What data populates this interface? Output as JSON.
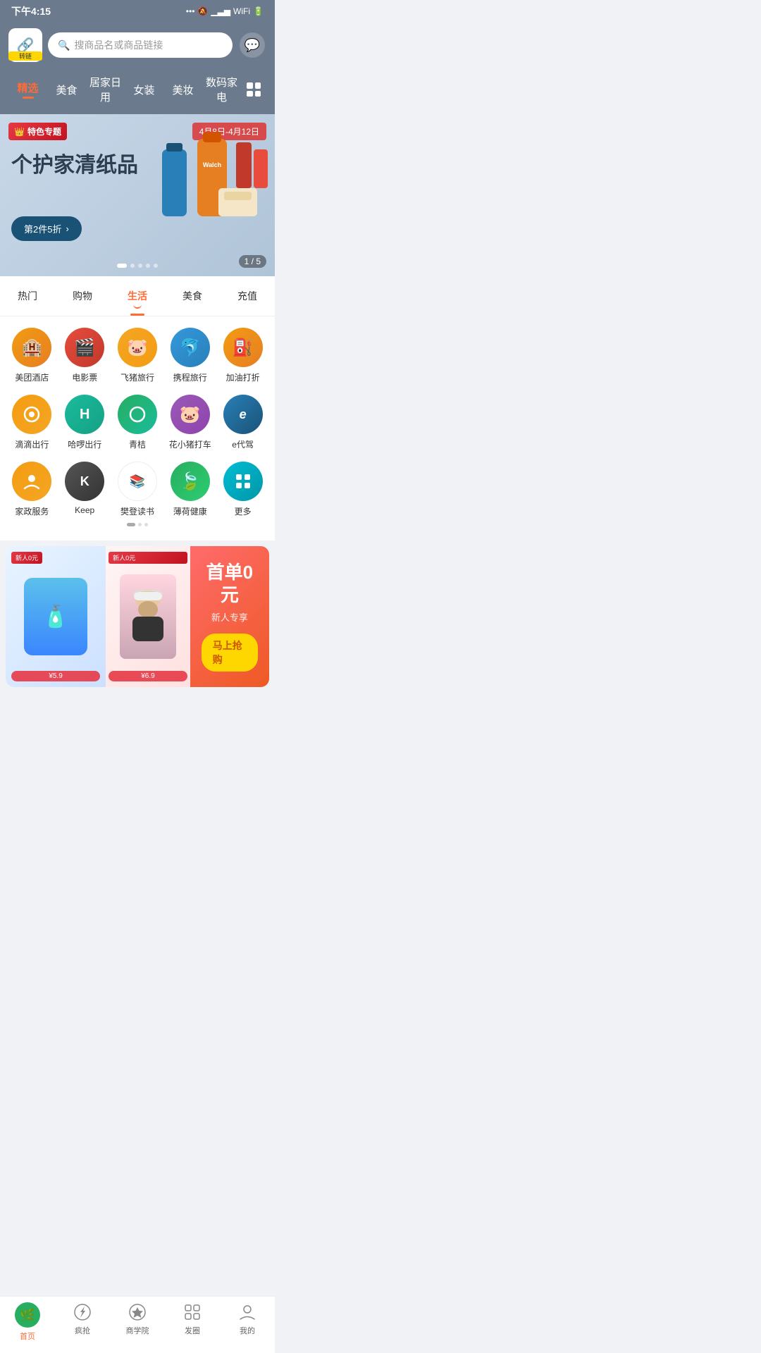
{
  "statusBar": {
    "time": "下午4:15",
    "icons": "... 🔕 📶 WiFi 🔋"
  },
  "header": {
    "logoLabel": "转链",
    "searchPlaceholder": "搜商品名或商品链接"
  },
  "navTabs": [
    {
      "id": "jingxuan",
      "label": "精选",
      "active": true
    },
    {
      "id": "meishi",
      "label": "美食",
      "active": false
    },
    {
      "id": "jujiadiyong",
      "label": "居家日用",
      "active": false
    },
    {
      "id": "nvzhuang",
      "label": "女装",
      "active": false
    },
    {
      "id": "meizhuang",
      "label": "美妆",
      "active": false
    },
    {
      "id": "shumajiadian",
      "label": "数码家电",
      "active": false
    }
  ],
  "banner": {
    "tag": "特色专题",
    "dateRange": "4月8日-4月12日",
    "title": "个护家清纸品",
    "ctaLabel": "第2件5折",
    "ctaArrow": "›",
    "counter": "1 / 5"
  },
  "categoryTabs": [
    {
      "label": "热门",
      "active": false
    },
    {
      "label": "购物",
      "active": false
    },
    {
      "label": "生活",
      "active": true
    },
    {
      "label": "美食",
      "active": false
    },
    {
      "label": "充值",
      "active": false
    }
  ],
  "appGrid": {
    "rows": [
      [
        {
          "id": "meituan-hotel",
          "icon": "🏨",
          "label": "美团酒店",
          "color": "ic-orange"
        },
        {
          "id": "movie-ticket",
          "icon": "🎬",
          "label": "电影票",
          "color": "ic-red"
        },
        {
          "id": "fliggy",
          "icon": "🐷",
          "label": "飞猪旅行",
          "color": "ic-orange2"
        },
        {
          "id": "ctrip",
          "icon": "🐬",
          "label": "携程旅行",
          "color": "ic-blue"
        },
        {
          "id": "gas-station",
          "icon": "⛽",
          "label": "加油打折",
          "color": "ic-amber"
        }
      ],
      [
        {
          "id": "didi",
          "icon": "◎",
          "label": "滴滴出行",
          "color": "ic-orange-light"
        },
        {
          "id": "hellobike",
          "icon": "H",
          "label": "哈啰出行",
          "color": "ic-teal"
        },
        {
          "id": "qingju",
          "icon": "◌",
          "label": "青桔",
          "color": "ic-green-teal"
        },
        {
          "id": "huaxiaozhu",
          "icon": "🐷",
          "label": "花小猪打车",
          "color": "ic-purple"
        },
        {
          "id": "edaijia",
          "icon": "e",
          "label": "e代驾",
          "color": "ic-blue2"
        }
      ],
      [
        {
          "id": "jiazhengliao",
          "icon": "☺",
          "label": "家政服务",
          "color": "ic-orange-light"
        },
        {
          "id": "keep",
          "icon": "K",
          "label": "Keep",
          "color": "ic-dark"
        },
        {
          "id": "fandengdushu",
          "icon": "📚",
          "label": "樊登读书",
          "color": "ic-white-border"
        },
        {
          "id": "bohe-health",
          "icon": "🍃",
          "label": "薄荷健康",
          "color": "ic-green"
        },
        {
          "id": "more",
          "icon": "⋮⋮",
          "label": "更多",
          "color": "ic-cyan"
        }
      ]
    ]
  },
  "promoCard": {
    "leftNewBadge": "新人0元",
    "leftPriceBadge": "¥5.9",
    "midNewBadge": "新人0元",
    "midPriceBadge": "¥6.9",
    "rightTitle": "首单0元",
    "rightSubtitle": "新人专享",
    "rightCta": "马上抢购"
  },
  "bottomNav": [
    {
      "id": "home",
      "icon": "🌿",
      "label": "首页",
      "active": true,
      "isCircle": false
    },
    {
      "id": "flash-sale",
      "icon": "🔥",
      "label": "疯抢",
      "active": false,
      "isCircle": true
    },
    {
      "id": "business-school",
      "icon": "👑",
      "label": "商学院",
      "active": false,
      "isCircle": true
    },
    {
      "id": "moments",
      "icon": "⊞",
      "label": "发圈",
      "active": false,
      "isCircle": true
    },
    {
      "id": "mine",
      "icon": "👤",
      "label": "我的",
      "active": false,
      "isCircle": true
    }
  ]
}
